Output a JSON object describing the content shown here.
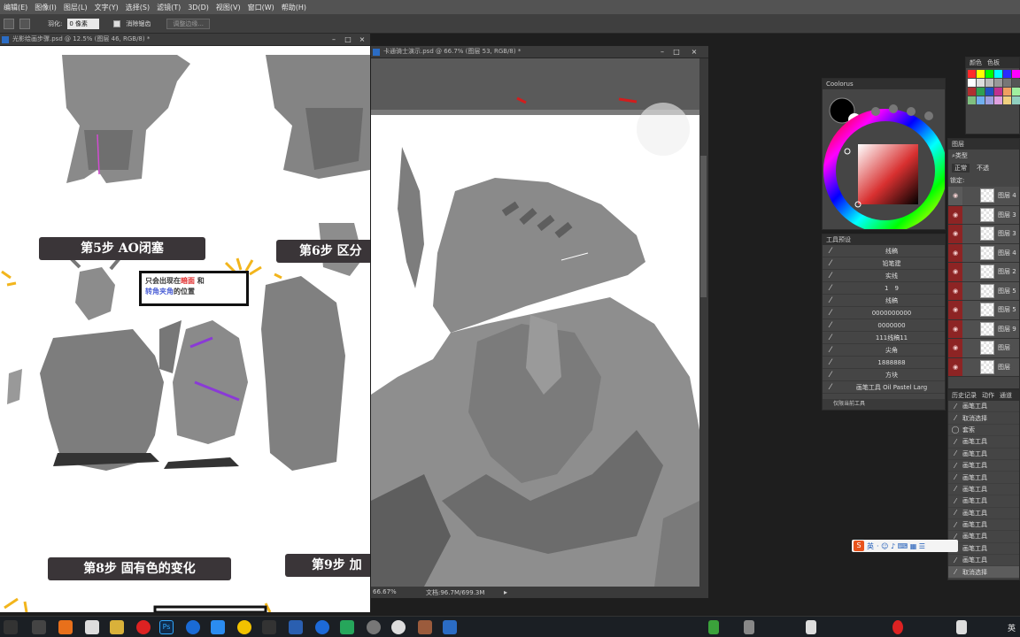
{
  "menu": [
    "编辑(E)",
    "图像(I)",
    "图层(L)",
    "文字(Y)",
    "选择(S)",
    "滤镜(T)",
    "3D(D)",
    "视图(V)",
    "窗口(W)",
    "帮助(H)"
  ],
  "options": {
    "feather_label": "羽化:",
    "feather_value": "0 像素",
    "antialias_label": "消除锯齿",
    "refine_button": "调整边缘..."
  },
  "doc1": {
    "title": "光影绘画步骤.psd @ 12.5% (图层 46, RGB/8) *",
    "banners": [
      "第5步 AO闭塞",
      "第6步 区分",
      "第8步 固有色的变化",
      "第9步 加"
    ],
    "bubble": {
      "p1": "只会出现在",
      "hl1": "暗面",
      "p2": " 和",
      "hl2": "转角夹角",
      "p3": "的位置"
    }
  },
  "doc2": {
    "title": "卡通骑士演示.psd @ 66.7% (图层 53, RGB/8) *",
    "zoom": "66.67%",
    "docsize": "文档:96.7M/699.3M"
  },
  "colorpanel": {
    "title": "Coolorus"
  },
  "toolpresets": {
    "title": "工具预设",
    "items": [
      "线稿",
      "铅笔建",
      "实线",
      "1　9",
      "线稿",
      "0000000000",
      "0000000",
      "111线稿11",
      "尖角",
      "1888888",
      "方块",
      "画笔工具 Oil Pastel Larg"
    ],
    "footer": "仅限当前工具"
  },
  "swatches": {
    "tabs": [
      "颜色",
      "色板"
    ]
  },
  "layers": {
    "title": "图层",
    "filter": "类型",
    "blend": "正常",
    "opacity_label": "不透",
    "lock_label": "锁定:",
    "rows": [
      "图层 4",
      "图层 3",
      "图层 3",
      "图层 4",
      "图层 2",
      "图层 5",
      "图层 5",
      "图层 9",
      "图层",
      "图层"
    ]
  },
  "history": {
    "tabs": [
      "历史记录",
      "动作",
      "通道"
    ],
    "items": [
      "画笔工具",
      "取消选择",
      "套索",
      "画笔工具",
      "画笔工具",
      "画笔工具",
      "画笔工具",
      "画笔工具",
      "画笔工具",
      "画笔工具",
      "画笔工具",
      "画笔工具",
      "画笔工具",
      "画笔工具",
      "取消选择"
    ]
  },
  "ime": {
    "label": "英"
  },
  "taskbar": {
    "lang": "英"
  }
}
